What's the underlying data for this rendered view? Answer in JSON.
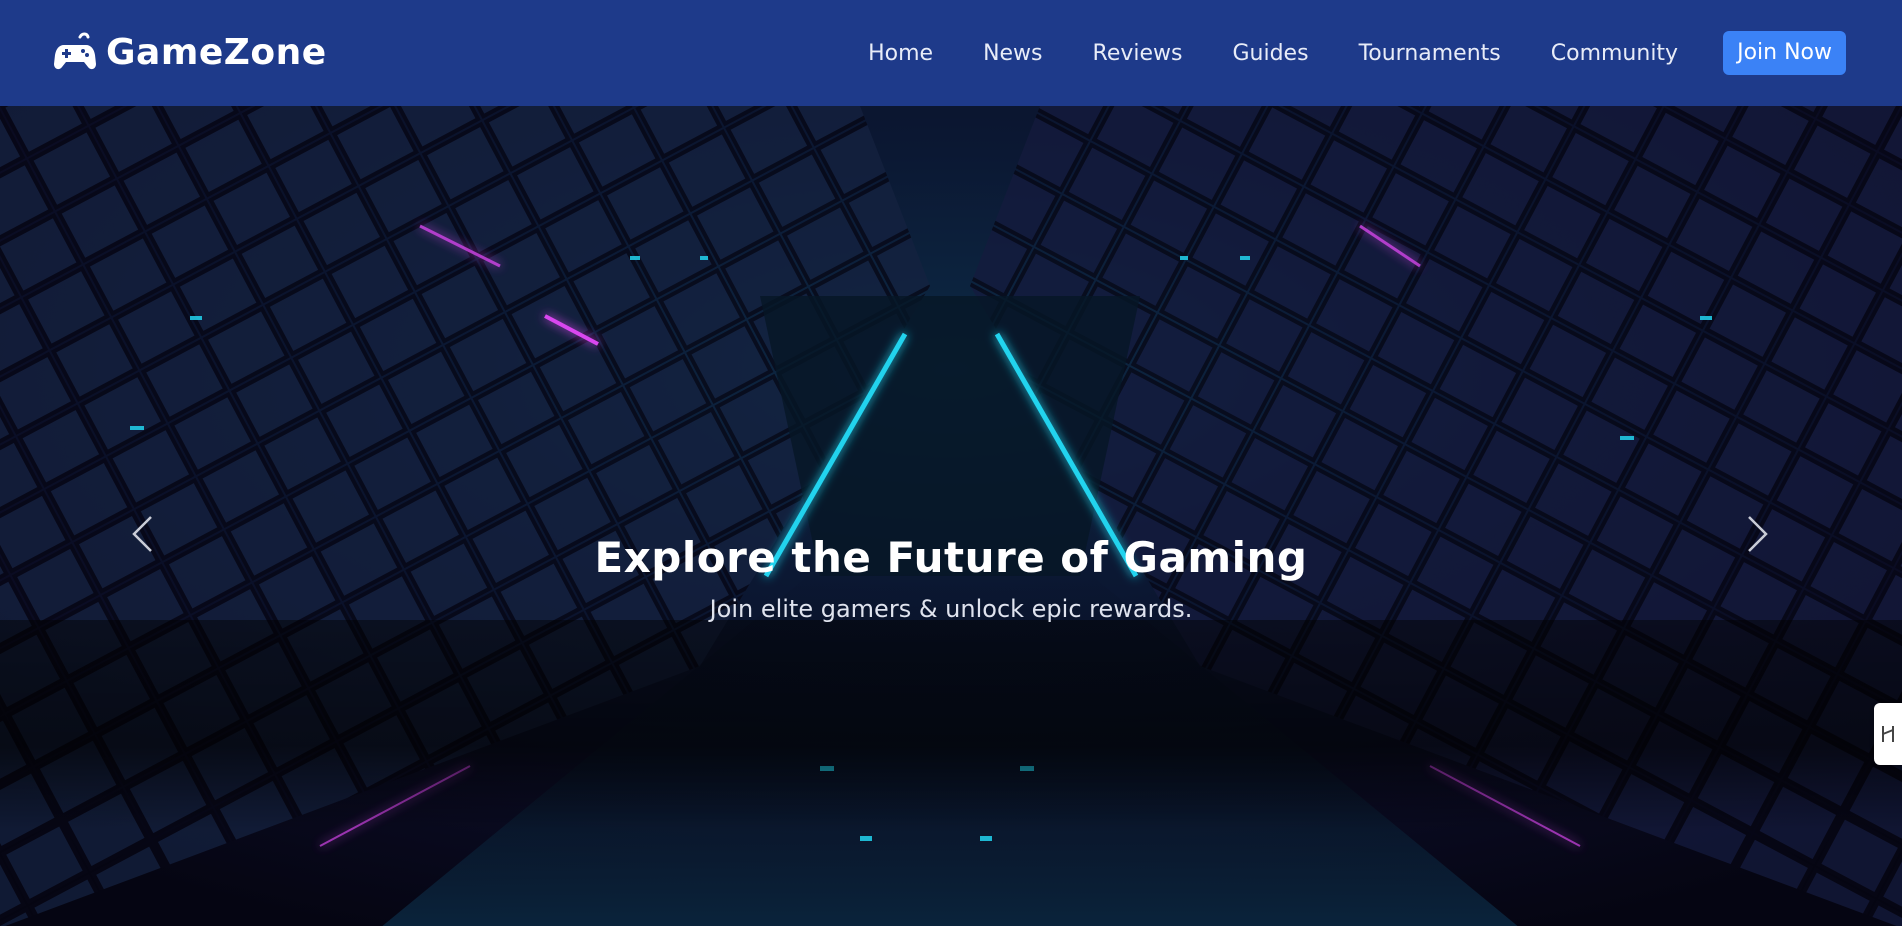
{
  "brand": {
    "name": "GameZone",
    "icon": "gamepad-icon"
  },
  "nav": {
    "items": [
      {
        "label": "Home"
      },
      {
        "label": "News"
      },
      {
        "label": "Reviews"
      },
      {
        "label": "Guides"
      },
      {
        "label": "Tournaments"
      },
      {
        "label": "Community"
      }
    ],
    "cta_label": "Join Now"
  },
  "hero": {
    "title": "Explore the Future of Gaming",
    "subtitle": "Join elite gamers & unlock epic rewards.",
    "prev_icon": "chevron-left-icon",
    "next_icon": "chevron-right-icon"
  },
  "colors": {
    "navbar_bg": "#1e3a8a",
    "cta_bg": "#3b82f6",
    "neon_cyan": "#22d3ee",
    "neon_magenta": "#d946ef"
  },
  "side_tab": {
    "icon": "toggle-icon"
  }
}
